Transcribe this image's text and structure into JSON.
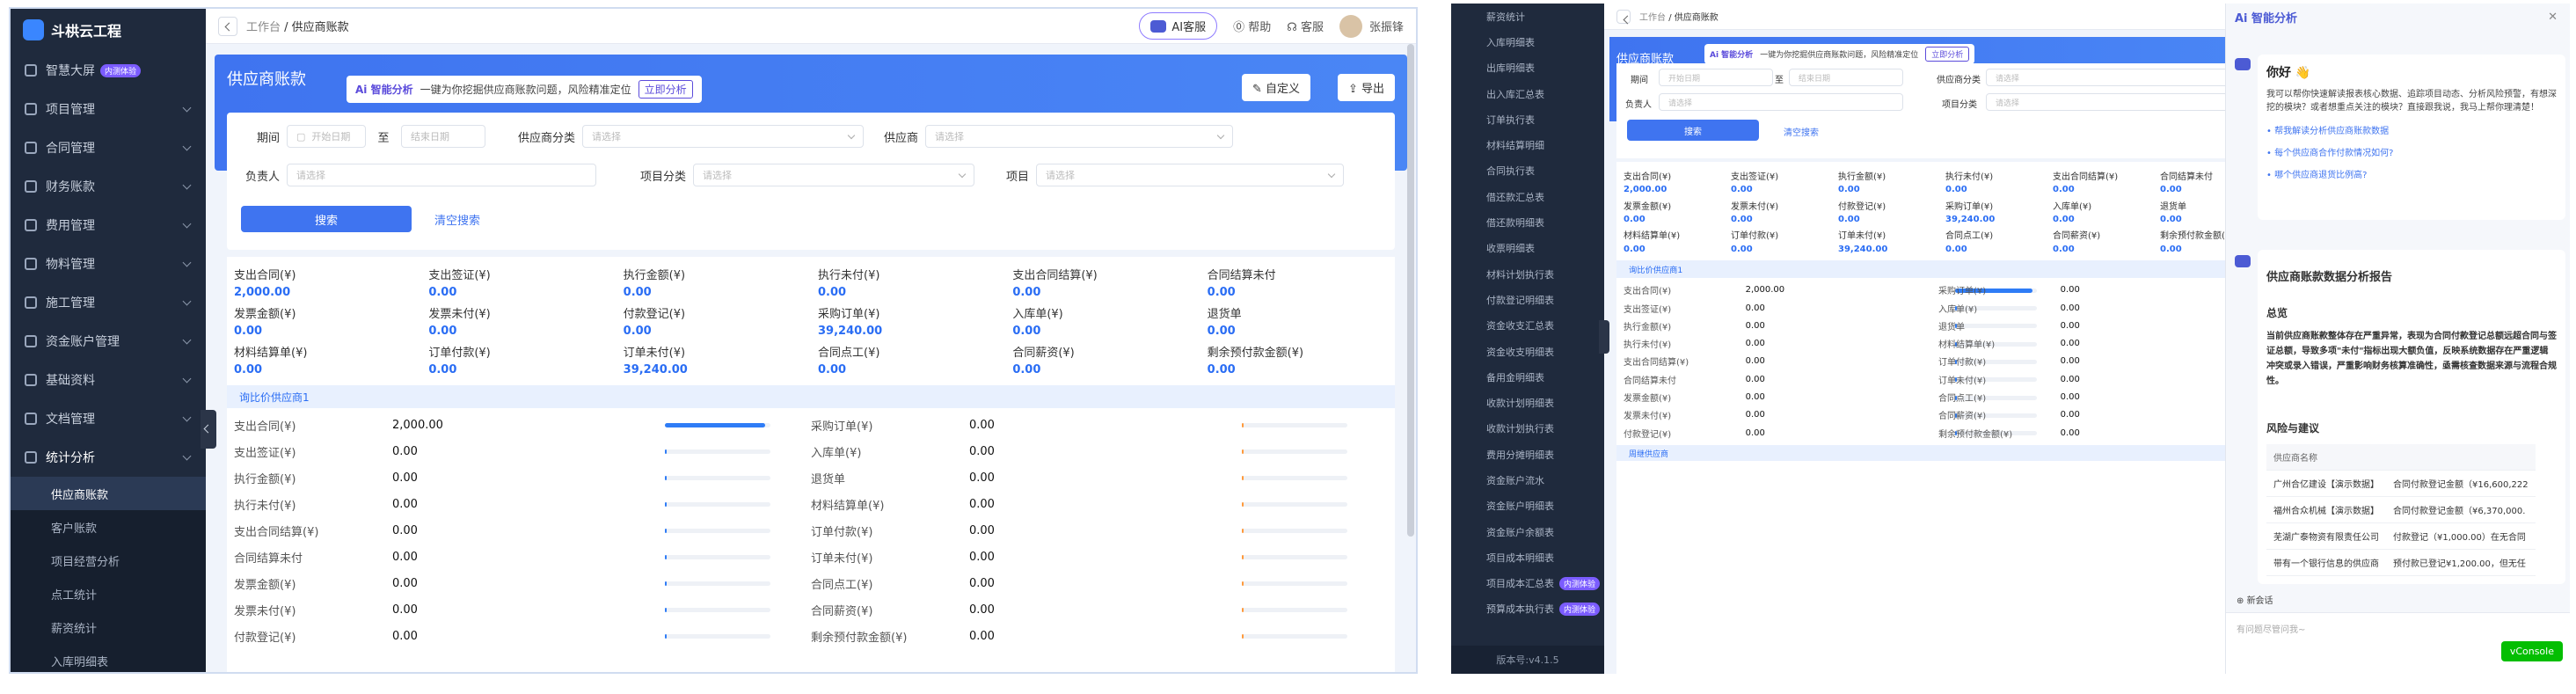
{
  "app": {
    "name": "斗栱云工程",
    "version": "版本号:v4.1.5"
  },
  "sidebar": {
    "items": [
      {
        "label": "智慧大屏",
        "badge": "内测体验"
      },
      {
        "label": "项目管理"
      },
      {
        "label": "合同管理"
      },
      {
        "label": "财务账款"
      },
      {
        "label": "费用管理"
      },
      {
        "label": "物料管理"
      },
      {
        "label": "施工管理"
      },
      {
        "label": "资金账户管理"
      },
      {
        "label": "基础资料"
      },
      {
        "label": "文档管理"
      },
      {
        "label": "统计分析"
      }
    ],
    "sub": [
      "供应商账款",
      "客户账款",
      "项目经营分析",
      "点工统计",
      "薪资统计",
      "入库明细表"
    ]
  },
  "sidebarB": {
    "items": [
      "薪资统计",
      "入库明细表",
      "出库明细表",
      "出入库汇总表",
      "订单执行表",
      "材料结算明细",
      "合同执行表",
      "借还款汇总表",
      "借还款明细表",
      "收票明细表",
      "材料计划执行表",
      "付款登记明细表",
      "资金收支汇总表",
      "资金收支明细表",
      "备用金明细表",
      "收款计划明细表",
      "收款计划执行表",
      "费用分摊明细表",
      "资金账户流水",
      "资金账户明细表",
      "资金账户余额表",
      "项目成本明细表",
      "项目成本汇总表",
      "预算成本执行表"
    ],
    "badges": {
      "22": "内测体验",
      "23": "内测体验"
    }
  },
  "topbar": {
    "back": "",
    "crumb_parent": "工作台",
    "crumb_current": "/ 供应商账款",
    "ai_service": "AI客服",
    "help": "帮助",
    "service": "客服",
    "user": "张振锋"
  },
  "hero": {
    "title": "供应商账款",
    "ai_label": "Ai 智能分析",
    "ai_desc": "一键为你挖掘供应商账款问题，风险精准定位",
    "ai_go": "立即分析",
    "custom": "自定义",
    "export": "导出"
  },
  "filter": {
    "period": "期间",
    "start_ph": "开始日期",
    "to": "至",
    "end_ph": "结束日期",
    "supplier_cat": "供应商分类",
    "supplier": "供应商",
    "owner": "负责人",
    "project_cat": "项目分类",
    "project": "项目",
    "select_ph": "请选择",
    "search": "搜索",
    "clear": "清空搜索"
  },
  "stats": [
    {
      "label": "支出合同(¥)",
      "value": "2,000.00"
    },
    {
      "label": "支出签证(¥)",
      "value": "0.00"
    },
    {
      "label": "执行金额(¥)",
      "value": "0.00"
    },
    {
      "label": "执行未付(¥)",
      "value": "0.00"
    },
    {
      "label": "支出合同结算(¥)",
      "value": "0.00"
    },
    {
      "label": "合同结算未付",
      "value": "0.00"
    },
    {
      "label": "发票金额(¥)",
      "value": "0.00"
    },
    {
      "label": "发票未付(¥)",
      "value": "0.00"
    },
    {
      "label": "付款登记(¥)",
      "value": "0.00"
    },
    {
      "label": "采购订单(¥)",
      "value": "39,240.00"
    },
    {
      "label": "入库单(¥)",
      "value": "0.00"
    },
    {
      "label": "退货单",
      "value": "0.00"
    },
    {
      "label": "材料结算单(¥)",
      "value": "0.00"
    },
    {
      "label": "订单付款(¥)",
      "value": "0.00"
    },
    {
      "label": "订单未付(¥)",
      "value": "39,240.00"
    },
    {
      "label": "合同点工(¥)",
      "value": "0.00"
    },
    {
      "label": "合同薪资(¥)",
      "value": "0.00"
    },
    {
      "label": "剩余预付款金额(¥)",
      "value": "0.00"
    }
  ],
  "group1": {
    "title": "询比价供应商1",
    "left": [
      {
        "label": "支出合同(¥)",
        "value": "2,000.00",
        "pct": 0.95
      },
      {
        "label": "支出签证(¥)",
        "value": "0.00",
        "pct": 0.01
      },
      {
        "label": "执行金额(¥)",
        "value": "0.00",
        "pct": 0.01
      },
      {
        "label": "执行未付(¥)",
        "value": "0.00",
        "pct": 0.01
      },
      {
        "label": "支出合同结算(¥)",
        "value": "0.00",
        "pct": 0.01
      },
      {
        "label": "合同结算未付",
        "value": "0.00",
        "pct": 0.01
      },
      {
        "label": "发票金额(¥)",
        "value": "0.00",
        "pct": 0.01
      },
      {
        "label": "发票未付(¥)",
        "value": "0.00",
        "pct": 0.01
      },
      {
        "label": "付款登记(¥)",
        "value": "0.00",
        "pct": 0.01
      }
    ],
    "right": [
      {
        "label": "采购订单(¥)",
        "value": "0.00"
      },
      {
        "label": "入库单(¥)",
        "value": "0.00"
      },
      {
        "label": "退货单",
        "value": "0.00"
      },
      {
        "label": "材料结算单(¥)",
        "value": "0.00"
      },
      {
        "label": "订单付款(¥)",
        "value": "0.00"
      },
      {
        "label": "订单未付(¥)",
        "value": "0.00"
      },
      {
        "label": "合同点工(¥)",
        "value": "0.00"
      },
      {
        "label": "合同薪资(¥)",
        "value": "0.00"
      },
      {
        "label": "剩余预付款金额(¥)",
        "value": "0.00"
      }
    ]
  },
  "group2": {
    "title": "周继供应商"
  },
  "ai": {
    "title": "Ai 智能分析",
    "greet": "你好 👋",
    "intro": "我可以帮你快速解读报表核心数据、追踪项目动态、分析风险预警，有想深挖的模块？或者想重点关注的模块？直接跟我说，我马上帮你理清楚！",
    "q": [
      "帮我解读分析供应商账款数据",
      "每个供应商合作付款情况如何?",
      "哪个供应商退货比例高?"
    ],
    "report_title": "供应商账款数据分析报告",
    "overview": "总览",
    "overview_text": "当前供应商账款整体存在严重异常，表现为合同付款登记总额远超合同与签证总额，导致多项\"未付\"指标出现大额负值，反映系统数据存在严重逻辑冲突或录入错误，严重影响财务核算准确性，亟需核查数据来源与流程合规性。",
    "risk": "风险与建议",
    "th": "供应商名称",
    "rows": [
      [
        "广州合亿建设【演示数据】",
        "合同付款登记金额（¥16,600,222"
      ],
      [
        "福州合众机械【演示数据】",
        "合同付款登记金额（¥6,370,000."
      ],
      [
        "芜湖广泰物资有限责任公司",
        "付款登记（¥1,000.00）在无合同"
      ],
      [
        "带有一个银行信息的供应商",
        "预付款已登记¥1,200.00，但无任"
      ]
    ],
    "new": "新会话",
    "input_ph": "有问题尽管问我~",
    "vconsole": "vConsole"
  }
}
